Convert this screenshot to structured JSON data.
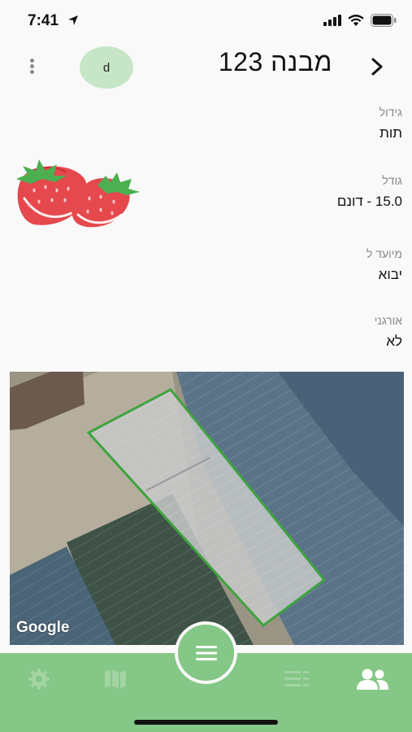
{
  "status_bar": {
    "time": "7:41"
  },
  "header": {
    "avatar_initial": "d",
    "title": "מבנה 123"
  },
  "fields": [
    {
      "label": "גידול",
      "value": "תות"
    },
    {
      "label": "גודל",
      "value": "15.0 - דונם"
    },
    {
      "label": "מיועד ל",
      "value": "יבוא"
    },
    {
      "label": "אורגני",
      "value": "לא"
    }
  ],
  "map": {
    "attribution": "Google"
  },
  "tabs": [
    {
      "icon": "gear-icon",
      "active": false
    },
    {
      "icon": "map-icon",
      "active": false
    },
    {
      "icon": "list-icon",
      "active": false
    },
    {
      "icon": "users-icon",
      "active": true
    }
  ],
  "colors": {
    "accent": "#85c786",
    "avatar_bg": "#c7e6c7",
    "plot_outline": "#3fa33f"
  }
}
